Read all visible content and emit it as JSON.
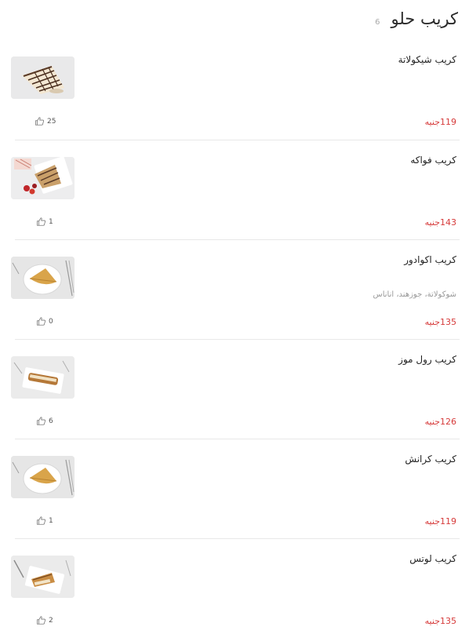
{
  "category": {
    "title": "كريب حلو",
    "count": "6"
  },
  "items": [
    {
      "name": "كريب شيكولاتة",
      "description": "",
      "price": "119",
      "currency": "جنيه",
      "likes": "25",
      "image": "chocolate-crepe"
    },
    {
      "name": "كريب فواكه",
      "description": "",
      "price": "143",
      "currency": "جنيه",
      "likes": "1",
      "image": "fruit-crepe"
    },
    {
      "name": "كريب اكوادور",
      "description": "شوكولاتة، جوزهند، اناناس",
      "price": "135",
      "currency": "جنيه",
      "likes": "0",
      "image": "plain-crepe"
    },
    {
      "name": "كريب رول موز",
      "description": "",
      "price": "126",
      "currency": "جنيه",
      "likes": "6",
      "image": "roll-crepe"
    },
    {
      "name": "كريب كرانش",
      "description": "",
      "price": "119",
      "currency": "جنيه",
      "likes": "1",
      "image": "plain-crepe"
    },
    {
      "name": "كريب لوتس",
      "description": "",
      "price": "135",
      "currency": "جنيه",
      "likes": "2",
      "image": "lotus-crepe"
    }
  ]
}
